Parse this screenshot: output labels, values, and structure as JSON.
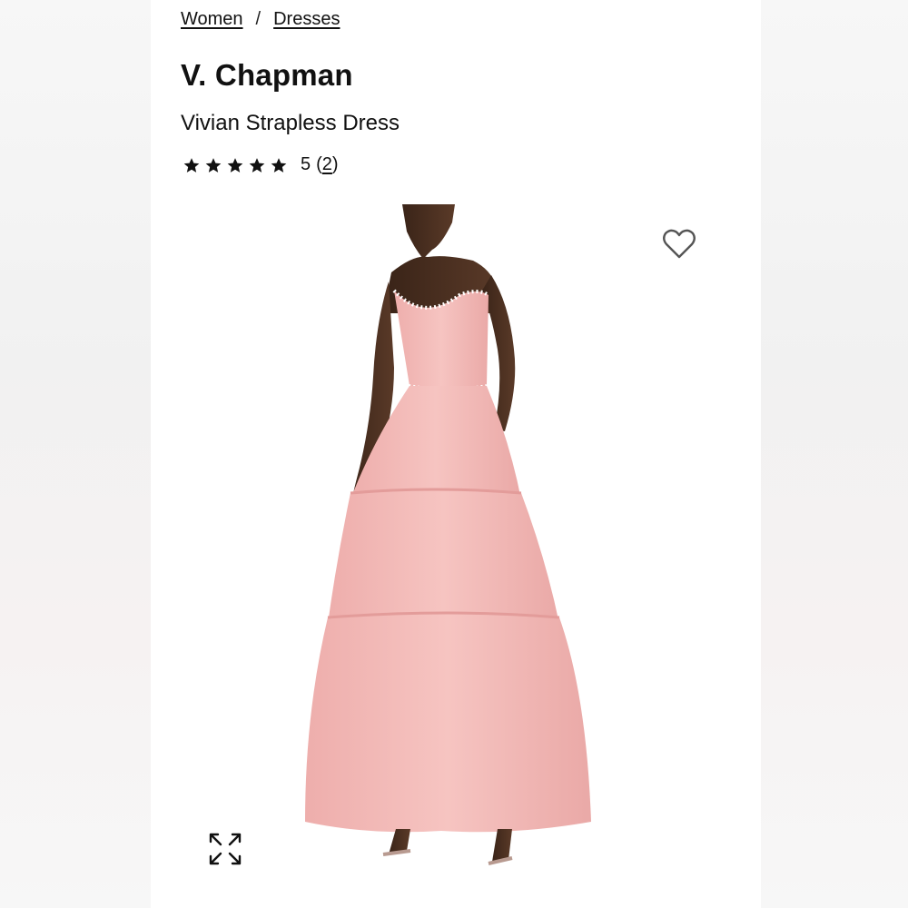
{
  "breadcrumb": {
    "items": [
      {
        "label": "Women"
      },
      {
        "label": "Dresses"
      }
    ],
    "separator": "/"
  },
  "product": {
    "brand": "V. Chapman",
    "name": "Vivian Strapless Dress",
    "rating": {
      "stars": 5,
      "score": "5",
      "count_open": "(",
      "count": "2",
      "count_close": ")"
    }
  },
  "icons": {
    "wishlist": "heart-outline-icon",
    "expand": "expand-arrows-icon",
    "star": "star-filled-icon"
  },
  "colors": {
    "dress_pink": "#f2b8b6",
    "text": "#111111"
  }
}
